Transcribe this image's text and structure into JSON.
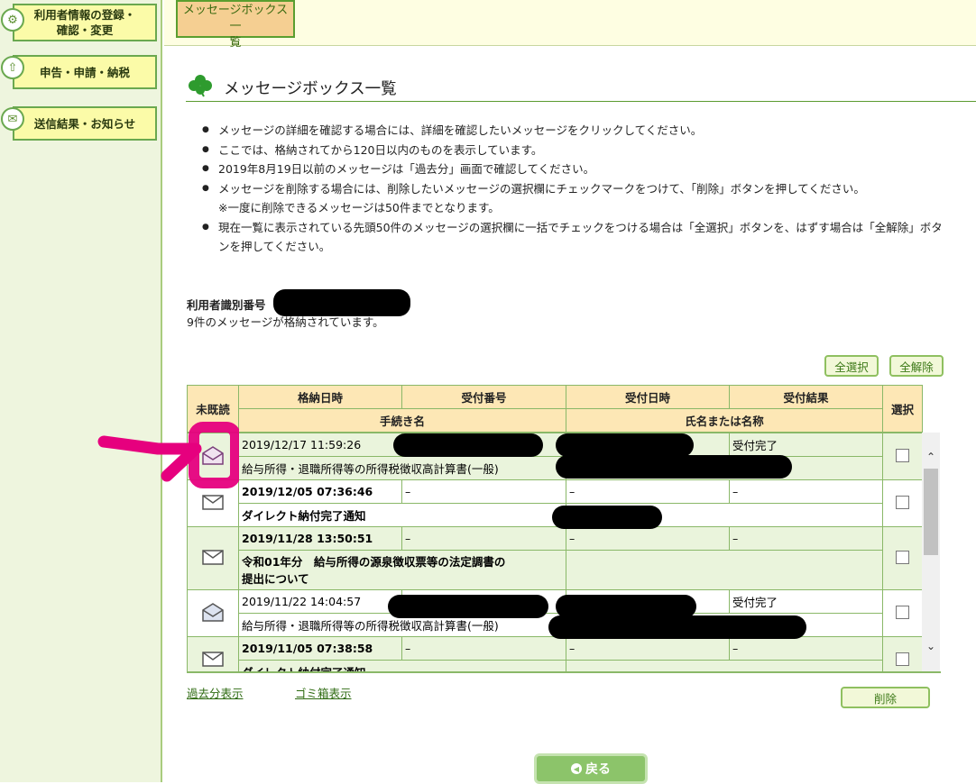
{
  "sidebar": {
    "items": [
      {
        "label_line1": "利用者情報の登録・",
        "label_line2": "確認・変更",
        "icon": "gear-icon"
      },
      {
        "label": "申告・申請・納税",
        "icon": "upload-icon"
      },
      {
        "label": "送信結果・お知らせ",
        "icon": "mail-icon"
      }
    ]
  },
  "topbar": {
    "tab_line1": "メッセージボックス一",
    "tab_line2": "覧"
  },
  "page": {
    "title": "メッセージボックス一覧",
    "title_icon": "clover-icon"
  },
  "notes": [
    "メッセージの詳細を確認する場合には、詳細を確認したいメッセージをクリックしてください。",
    "ここでは、格納されてから120日以内のものを表示しています。",
    "2019年8月19日以前のメッセージは「過去分」画面で確認してください。",
    "メッセージを削除する場合には、削除したいメッセージの選択欄にチェックマークをつけて、「削除」ボタンを押してください。",
    "※一度に削除できるメッセージは50件までとなります。",
    "現在一覧に表示されている先頭50件のメッセージの選択欄に一括でチェックをつける場合は「全選択」ボタンを、はずす場合は「全解除」ボタ",
    "ンを押してください。"
  ],
  "user": {
    "id_label": "利用者識別番号",
    "count_text": "9件のメッセージが格納されています。"
  },
  "buttons": {
    "select_all": "全選択",
    "deselect_all": "全解除",
    "delete": "削除",
    "back": "戻る"
  },
  "table": {
    "headers": {
      "unread": "未既読",
      "stored_at": "格納日時",
      "receipt_no": "受付番号",
      "received_at": "受付日時",
      "result": "受付結果",
      "select": "選択",
      "procedure": "手続き名",
      "name": "氏名または名称"
    },
    "rows": [
      {
        "stored_at": "2019/12/17 11:59:26",
        "receipt_no": "",
        "received_at": "",
        "result": "受付完了",
        "procedure": "給与所得・退職所得等の所得税徴収高計算書(一般)",
        "procedure_line2": "",
        "name": "",
        "read": true,
        "bold": false
      },
      {
        "stored_at": "2019/12/05 07:36:46",
        "receipt_no": "–",
        "received_at": "–",
        "result": "–",
        "procedure": "ダイレクト納付完了通知",
        "procedure_line2": "",
        "name": "",
        "read": false,
        "bold": true
      },
      {
        "stored_at": "2019/11/28 13:50:51",
        "receipt_no": "–",
        "received_at": "–",
        "result": "–",
        "procedure": "令和01年分　給与所得の源泉徴収票等の法定調書の",
        "procedure_line2": "提出について",
        "name": "",
        "read": false,
        "bold": true
      },
      {
        "stored_at": "2019/11/22 14:04:57",
        "receipt_no": "",
        "received_at": "",
        "result": "受付完了",
        "procedure": "給与所得・退職所得等の所得税徴収高計算書(一般)",
        "procedure_line2": "",
        "name": "",
        "read": true,
        "bold": false
      },
      {
        "stored_at": "2019/11/05 07:38:58",
        "receipt_no": "–",
        "received_at": "–",
        "result": "–",
        "procedure": "ダイレクト納付完了通知",
        "procedure_line2": "",
        "name": "",
        "read": false,
        "bold": true
      }
    ]
  },
  "links": {
    "past": "過去分表示",
    "trash": "ゴミ箱表示"
  },
  "colors": {
    "accent_green": "#5b9b2f",
    "header_bg": "#fde7b5",
    "annotation_pink": "#e6007e",
    "sidebar_button_bg": "#fbfba8"
  }
}
